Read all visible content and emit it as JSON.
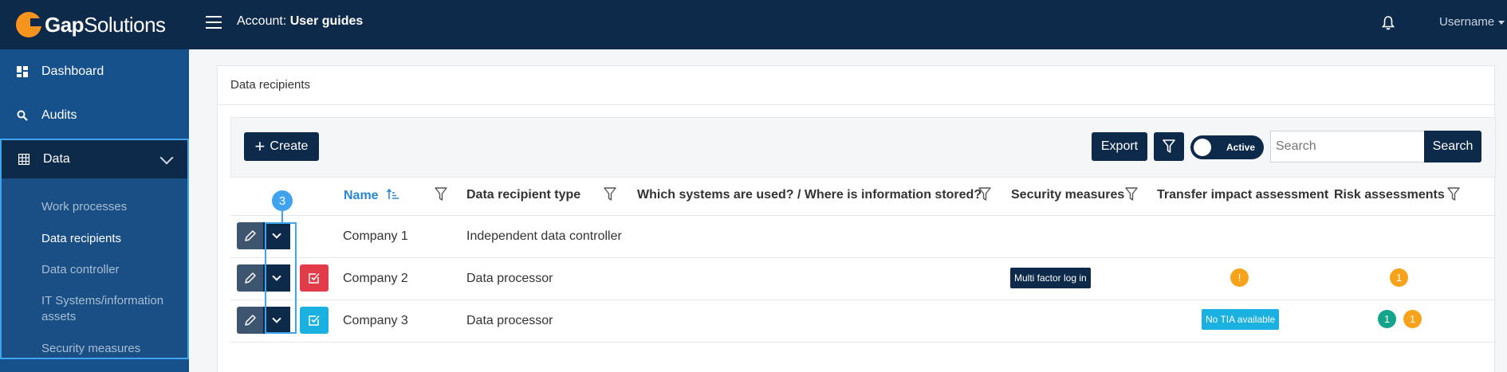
{
  "brand": {
    "logo_bold": "Gap",
    "logo_light": "Solutions"
  },
  "header": {
    "account_label": "Account:",
    "account_name": "User guides",
    "username": "Username"
  },
  "sidebar": {
    "items": [
      {
        "label": "Dashboard",
        "icon": "dashboard-icon"
      },
      {
        "label": "Audits",
        "icon": "search-icon"
      }
    ],
    "data_section": {
      "label": "Data",
      "icon": "table-icon",
      "children": [
        "Work processes",
        "Data recipients",
        "Data controller",
        "IT Systems/information assets",
        "Security measures"
      ],
      "active": "Data recipients"
    }
  },
  "page": {
    "title": "Data recipients"
  },
  "toolbar": {
    "create_label": "Create",
    "export_label": "Export",
    "toggle_label": "Active",
    "search_placeholder": "Search",
    "search_button": "Search"
  },
  "table": {
    "headers": {
      "name": "Name",
      "type": "Data recipient type",
      "systems": "Which systems are used? / Where is information stored?",
      "security": "Security measures",
      "tia": "Transfer impact assessment",
      "risk": "Risk assessments"
    },
    "rows": [
      {
        "name": "Company 1",
        "type": "Independent data controller"
      },
      {
        "name": "Company 2",
        "type": "Data processor",
        "security_tag": "Multi factor log in",
        "tia_badge": "!",
        "risk_badges": [
          "1"
        ]
      },
      {
        "name": "Company 3",
        "type": "Data processor",
        "tia_tag": "No TIA available",
        "risk_badges": [
          "1",
          "1"
        ]
      }
    ]
  },
  "annotation": {
    "step": "3"
  },
  "colors": {
    "navy": "#0e2a4a",
    "sidebar_blue": "#17518c",
    "highlight_blue": "#3fa3f0",
    "red": "#e23b4a",
    "cyan": "#1ab0e0",
    "orange": "#f7a21b",
    "teal": "#14a38b"
  }
}
